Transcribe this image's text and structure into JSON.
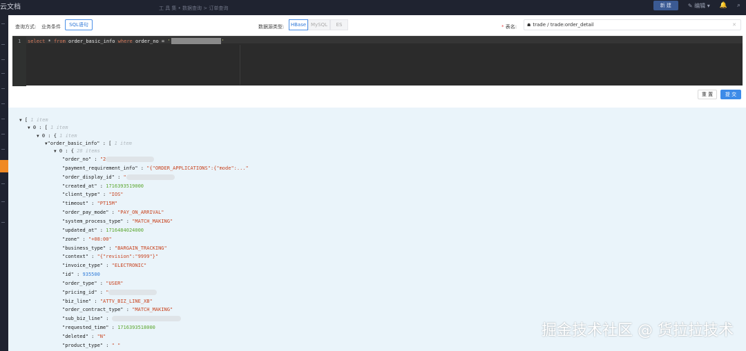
{
  "topbar": {
    "brand": "云文档",
    "breadcrumb": "工 具 集 • 数据查询 > 订单查询",
    "primary_button": "新 建",
    "edit_label": "编辑"
  },
  "query": {
    "mode_label": "查询方式:",
    "mode_option_business": "业务条件",
    "mode_option_sql": "SQL语句",
    "datasource_label": "数据源类型:",
    "datasources": [
      "HBase",
      "MySQL",
      "ES"
    ],
    "datasource_selected": "HBase",
    "table_label": "表名:",
    "table_required_mark": "*",
    "table_value": "trade / trade:order_detail"
  },
  "editor": {
    "line_number": "1",
    "sql_select": "select",
    "sql_star": " * ",
    "sql_from": "from",
    "sql_table": " order_basic_info ",
    "sql_where": "where",
    "sql_col": " order_no = ",
    "sql_quote_open": "'",
    "sql_quote_close": "'"
  },
  "actions": {
    "reset": "重 置",
    "submit": "提 交"
  },
  "result": {
    "root_bracket": "[",
    "root_meta": "1 item",
    "l1_index": "0 : [",
    "l1_meta": "1 item",
    "l2_index": "0 : {",
    "l2_meta": "1 item",
    "l3_key": "\"order_basic_info\"",
    "l3_open": "[",
    "l3_meta": "1 item",
    "l4_index": "0 : {",
    "l4_meta": "28 items",
    "fields": [
      {
        "key": "\"order_no\"",
        "value": "\"2",
        "type": "s",
        "blur": 70
      },
      {
        "key": "\"payment_requirement_info\"",
        "value": "\"{\"ORDER_APPLICATIONS\":{\"mode\":...\"",
        "type": "s",
        "blur": 0
      },
      {
        "key": "\"order_display_id\"",
        "value": "\"",
        "type": "s",
        "blur": 70
      },
      {
        "key": "\"created_at\"",
        "value": "1716393519000",
        "type": "n",
        "blur": 0
      },
      {
        "key": "\"client_type\"",
        "value": "\"IOS\"",
        "type": "s",
        "blur": 0
      },
      {
        "key": "\"timeout\"",
        "value": "\"PT15M\"",
        "type": "s",
        "blur": 0
      },
      {
        "key": "\"order_pay_mode\"",
        "value": "\"PAY_ON_ARRIVAL\"",
        "type": "s",
        "blur": 0
      },
      {
        "key": "\"system_process_type\"",
        "value": "\"MATCH_MAKING\"",
        "type": "s",
        "blur": 0
      },
      {
        "key": "\"updated_at\"",
        "value": "1716484024000",
        "type": "n",
        "blur": 0
      },
      {
        "key": "\"zone\"",
        "value": "\"+08:00\"",
        "type": "s",
        "blur": 0
      },
      {
        "key": "\"business_type\"",
        "value": "\"BARGAIN_TRACKING\"",
        "type": "s",
        "blur": 0
      },
      {
        "key": "\"context\"",
        "value": "\"{\"revision\":\"9999\"}\"",
        "type": "s",
        "blur": 0
      },
      {
        "key": "\"invoice_type\"",
        "value": "\"ELECTRONIC\"",
        "type": "s",
        "blur": 0
      },
      {
        "key": "\"id\"",
        "value": "935500",
        "type": "n2",
        "blur": 0
      },
      {
        "key": "\"order_type\"",
        "value": "\"USER\"",
        "type": "s",
        "blur": 0
      },
      {
        "key": "\"pricing_id\"",
        "value": "\"",
        "type": "s",
        "blur": 70
      },
      {
        "key": "\"biz_line\"",
        "value": "\"ATTV_BIZ_LINE_XB\"",
        "type": "s",
        "blur": 0
      },
      {
        "key": "\"order_contract_type\"",
        "value": "\"MATCH_MAKING\"",
        "type": "s",
        "blur": 0
      },
      {
        "key": "\"sub_biz_line\"",
        "value": "",
        "type": "s",
        "blur": 100
      },
      {
        "key": "\"requested_time\"",
        "value": "1716393518000",
        "type": "n",
        "blur": 0
      },
      {
        "key": "\"deleted\"",
        "value": "\"N\"",
        "type": "s",
        "blur": 0
      },
      {
        "key": "\"product_type\"",
        "value": "\"                    \"",
        "type": "s",
        "blur": 0
      }
    ]
  },
  "watermark": "掘金技术社区 @ 货拉拉技术",
  "colors": {
    "accent": "#3d8be8",
    "string": "#c8421d",
    "number": "#5aa62d",
    "result_bg": "#eaf4fa",
    "editor_bg": "#2b2b2b"
  }
}
